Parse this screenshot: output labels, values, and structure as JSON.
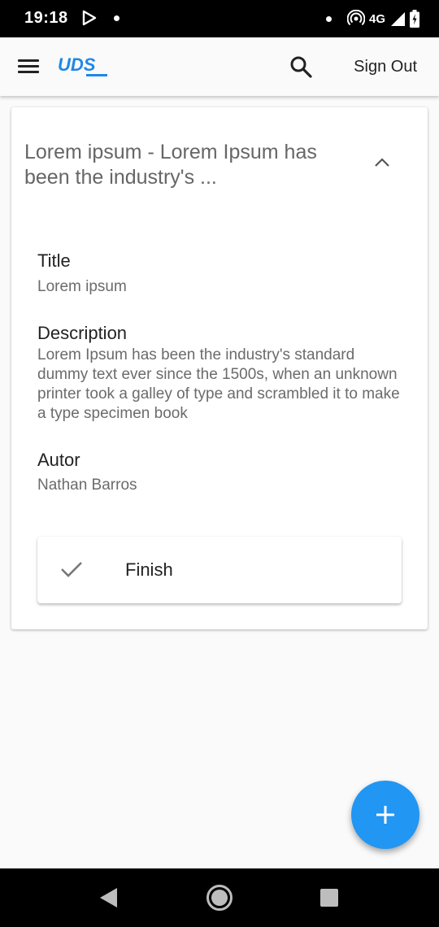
{
  "status_bar": {
    "time": "19:18",
    "network": "4G"
  },
  "app_bar": {
    "logo_text": "UDS",
    "sign_out_label": "Sign Out"
  },
  "card": {
    "title": "Lorem ipsum - Lorem Ipsum has been the industry's ...",
    "fields": [
      {
        "label": "Title",
        "value": "Lorem ipsum"
      },
      {
        "label": "Description",
        "value": "Lorem Ipsum has been the industry's standard dummy text ever since the 1500s, when an unknown printer took a galley of type and scrambled it to make a type specimen book"
      },
      {
        "label": "Autor",
        "value": "Nathan Barros"
      }
    ],
    "finish_label": "Finish"
  },
  "colors": {
    "accent": "#2196f3",
    "logo": "#1e88e5"
  },
  "icons": {
    "menu": "menu-icon",
    "search": "search-icon",
    "collapse": "chevron-up-icon",
    "finish": "check-icon",
    "fab": "plus-icon"
  }
}
